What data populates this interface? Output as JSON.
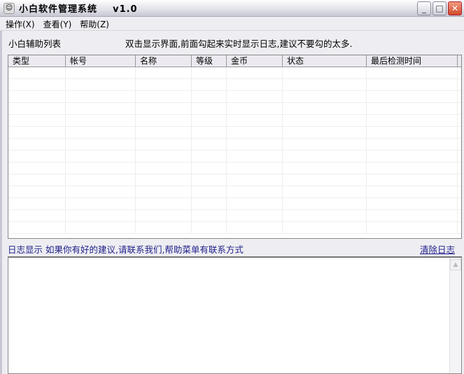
{
  "window": {
    "title": "小白软件管理系统    v1.0",
    "minimize": "_",
    "maximize": "□",
    "close": "✕"
  },
  "menu": [
    {
      "label": "操作(X)"
    },
    {
      "label": "查看(Y)"
    },
    {
      "label": "帮助(Z)"
    }
  ],
  "list": {
    "label": "小白辅助列表",
    "hint": "双击显示界面,前面勾起来实时显示日志,建议不要勾的太多.",
    "columns": [
      "类型",
      "帐号",
      "名称",
      "等级",
      "金币",
      "状态",
      "最后检测时间"
    ]
  },
  "log": {
    "label": "日志显示  如果你有好的建议,请联系我们,帮助菜单有联系方式",
    "clear": "清除日志"
  }
}
